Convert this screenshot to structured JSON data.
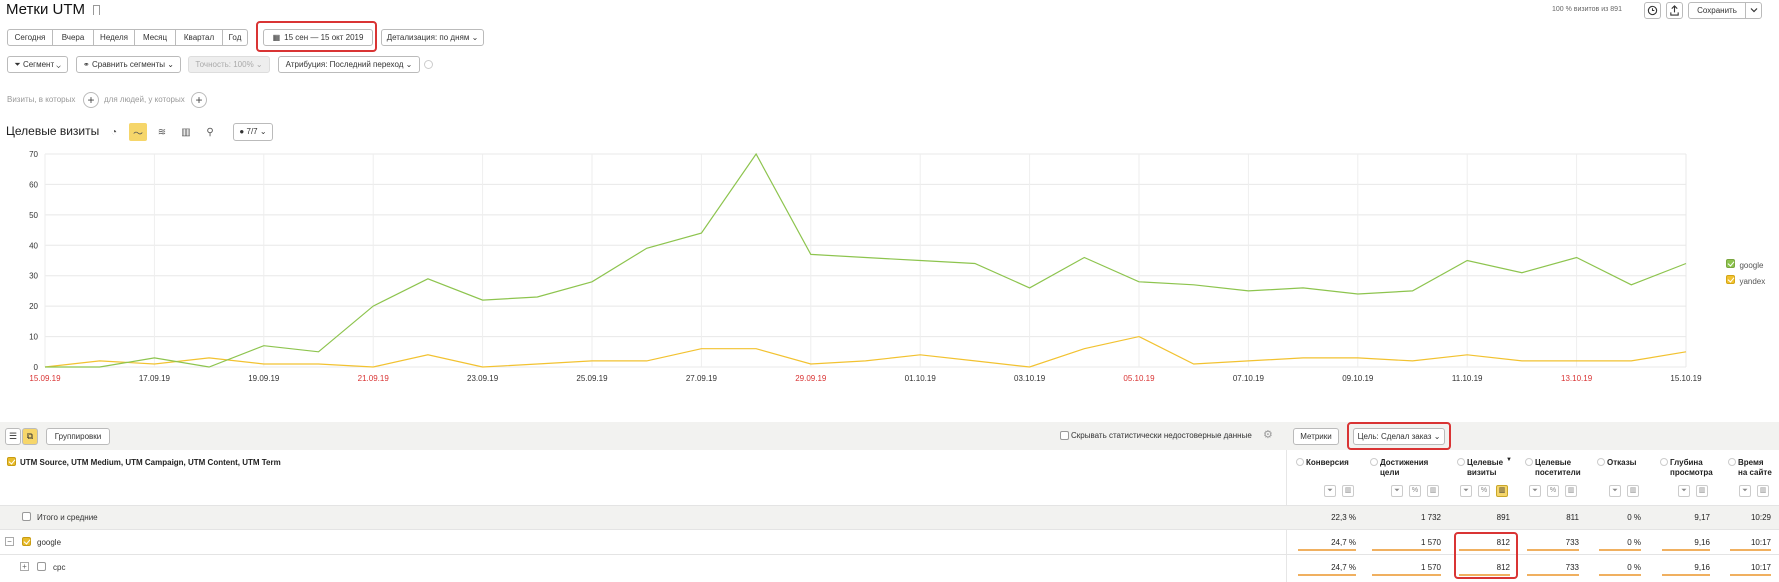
{
  "header": {
    "title": "Метки UTM",
    "visits_note": "100 % визитов из 891",
    "save_label": "Сохранить"
  },
  "periods": [
    "Сегодня",
    "Вчера",
    "Неделя",
    "Месяц",
    "Квартал",
    "Год"
  ],
  "date_range": "15 сен — 15 окт 2019",
  "detail": "Детализация: по дням",
  "filters": {
    "segment": "Сегмент",
    "compare": "Сравнить сегменты",
    "accuracy": "Точность: 100%",
    "attribution": "Атрибуция: Последний переход"
  },
  "conditions": {
    "visits_label": "Визиты, в которых",
    "people_label": "для людей, у которых"
  },
  "chart_header": {
    "title": "Целевые визиты",
    "series_count": "7/7"
  },
  "chart_data": {
    "type": "line",
    "x": [
      "15.09.19",
      "16.09.19",
      "17.09.19",
      "18.09.19",
      "19.09.19",
      "20.09.19",
      "21.09.19",
      "22.09.19",
      "23.09.19",
      "24.09.19",
      "25.09.19",
      "26.09.19",
      "27.09.19",
      "28.09.19",
      "29.09.19",
      "30.09.19",
      "01.10.19",
      "02.10.19",
      "03.10.19",
      "04.10.19",
      "05.10.19",
      "06.10.19",
      "07.10.19",
      "08.10.19",
      "09.10.19",
      "10.10.19",
      "11.10.19",
      "12.10.19",
      "13.10.19",
      "14.10.19",
      "15.10.19"
    ],
    "x_tick_labels": [
      "15.09.19",
      "17.09.19",
      "19.09.19",
      "21.09.19",
      "23.09.19",
      "25.09.19",
      "27.09.19",
      "29.09.19",
      "01.10.19",
      "03.10.19",
      "05.10.19",
      "07.10.19",
      "09.10.19",
      "11.10.19",
      "13.10.19",
      "15.10.19"
    ],
    "weekend_ticks": [
      "15.09.19",
      "21.09.19",
      "29.09.19",
      "05.10.19",
      "13.10.19"
    ],
    "y_ticks": [
      0,
      10,
      20,
      30,
      40,
      50,
      60,
      70
    ],
    "ylim": [
      0,
      70
    ],
    "grid": true,
    "legend_position": "right",
    "series": [
      {
        "name": "google",
        "color": "#8dc44e",
        "values": [
          0,
          0,
          3,
          0,
          7,
          5,
          20,
          29,
          22,
          23,
          28,
          39,
          44,
          70,
          37,
          36,
          35,
          34,
          26,
          36,
          28,
          27,
          25,
          26,
          24,
          25,
          35,
          31,
          36,
          27,
          34
        ]
      },
      {
        "name": "yandex",
        "color": "#f2c230",
        "values": [
          0,
          2,
          1,
          3,
          1,
          1,
          0,
          4,
          0,
          1,
          2,
          2,
          6,
          6,
          1,
          2,
          4,
          2,
          0,
          6,
          10,
          1,
          2,
          3,
          3,
          2,
          4,
          2,
          2,
          2,
          5
        ]
      }
    ]
  },
  "table_toolbar": {
    "groupings": "Группировки",
    "hide_label": "Скрывать статистически недостоверные данные",
    "metrics": "Метрики",
    "goal": "Цель: Сделал заказ"
  },
  "table": {
    "dimension_header": "UTM Source, UTM Medium, UTM Campaign, UTM Content, UTM Term",
    "columns": [
      {
        "l1": "Конверсия",
        "l2": ""
      },
      {
        "l1": "Достижения",
        "l2": "цели"
      },
      {
        "l1": "Целевые",
        "l2": "визиты"
      },
      {
        "l1": "Целевые",
        "l2": "посетители"
      },
      {
        "l1": "Отказы",
        "l2": ""
      },
      {
        "l1": "Глубина",
        "l2": "просмотра"
      },
      {
        "l1": "Время",
        "l2": "на сайте"
      }
    ],
    "totals": {
      "label": "Итого и средние",
      "values": [
        "22,3 %",
        "1 732",
        "891",
        "811",
        "0 %",
        "9,17",
        "10:29"
      ]
    },
    "rows": [
      {
        "label": "google",
        "values": [
          "24,7 %",
          "1 570",
          "812",
          "733",
          "0 %",
          "9,16",
          "10:17"
        ]
      },
      {
        "label": "cpc",
        "values": [
          "24,7 %",
          "1 570",
          "812",
          "733",
          "0 %",
          "9,16",
          "10:17"
        ]
      }
    ]
  }
}
